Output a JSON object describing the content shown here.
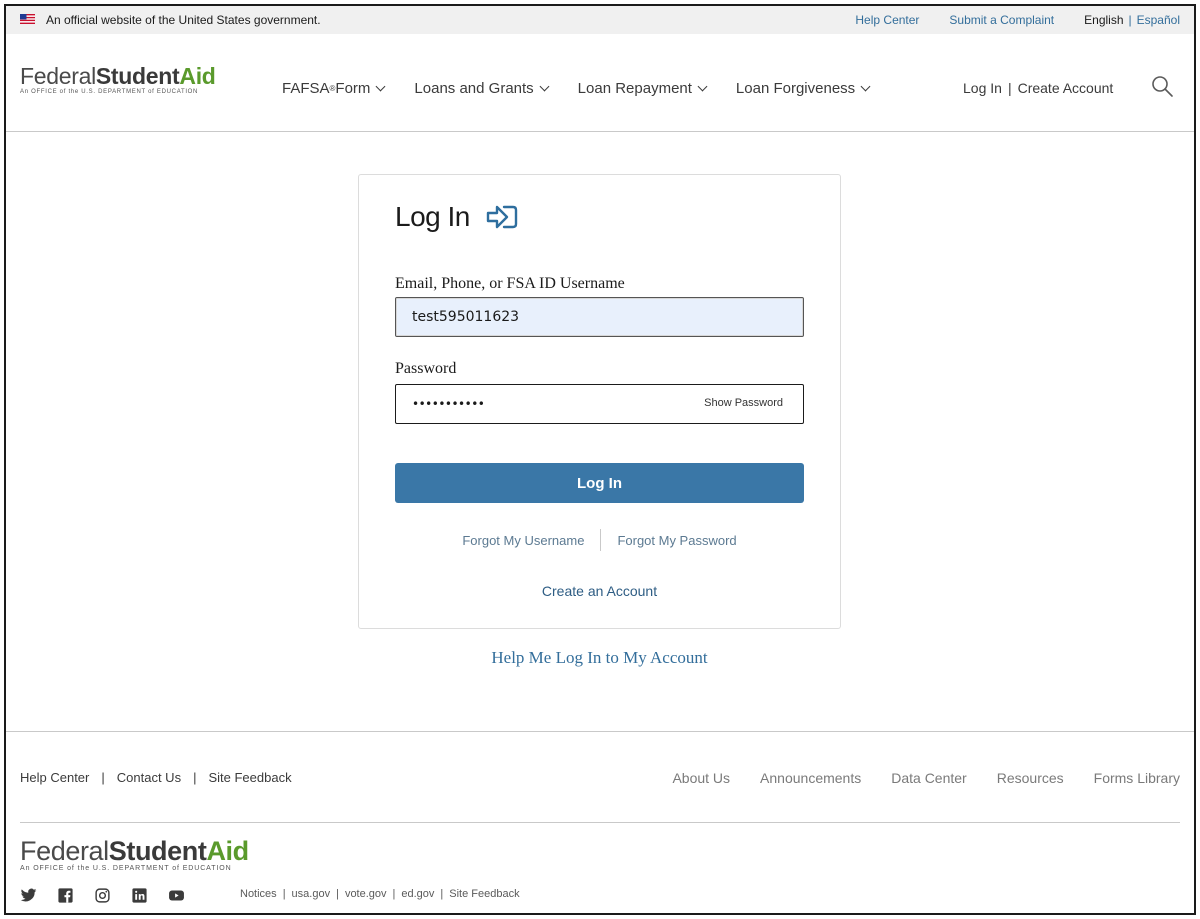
{
  "gov_banner": {
    "official_text": "An official website of the United States government.",
    "help_center": "Help Center",
    "submit_complaint": "Submit a Complaint",
    "english": "English",
    "separator": "|",
    "espanol": "Español"
  },
  "header": {
    "logo": {
      "word1": "Federal",
      "word2": "Student",
      "word3": "Aid",
      "tagline": "An OFFICE of the U.S. DEPARTMENT of EDUCATION"
    },
    "nav": [
      {
        "label": "FAFSA",
        "sup": "®",
        "suffix": " Form"
      },
      {
        "label": "Loans and Grants"
      },
      {
        "label": "Loan Repayment"
      },
      {
        "label": "Loan Forgiveness"
      }
    ],
    "login": "Log In",
    "separator": "|",
    "create_account": "Create Account",
    "icons": {
      "search": "search-icon",
      "chevron": "chevron-down-icon"
    }
  },
  "login_card": {
    "title": "Log In",
    "username_label": "Email, Phone, or FSA ID Username",
    "username_value": "test595011623",
    "password_label": "Password",
    "password_value": "•••••••••••",
    "show_password": "Show Password",
    "login_button": "Log In",
    "forgot_username": "Forgot My Username",
    "forgot_password": "Forgot My Password",
    "create_account": "Create an Account",
    "icons": {
      "login": "login-arrow-icon"
    },
    "colors": {
      "button": "#3a77a7",
      "field_fill": "#e8f0fc"
    }
  },
  "help_link": "Help Me Log In to My Account",
  "footer": {
    "left_links": [
      "Help Center",
      "Contact Us",
      "Site Feedback"
    ],
    "separator": "|",
    "right_links": [
      "About Us",
      "Announcements",
      "Data Center",
      "Resources",
      "Forms Library"
    ],
    "logo": {
      "word1": "Federal",
      "word2": "Student",
      "word3": "Aid",
      "tagline": "An OFFICE of the U.S. DEPARTMENT of EDUCATION"
    },
    "social_icons": [
      "twitter-icon",
      "facebook-icon",
      "instagram-icon",
      "linkedin-icon",
      "youtube-icon"
    ],
    "legal_links": [
      "Notices",
      "usa.gov",
      "vote.gov",
      "ed.gov",
      "Site Feedback"
    ]
  }
}
